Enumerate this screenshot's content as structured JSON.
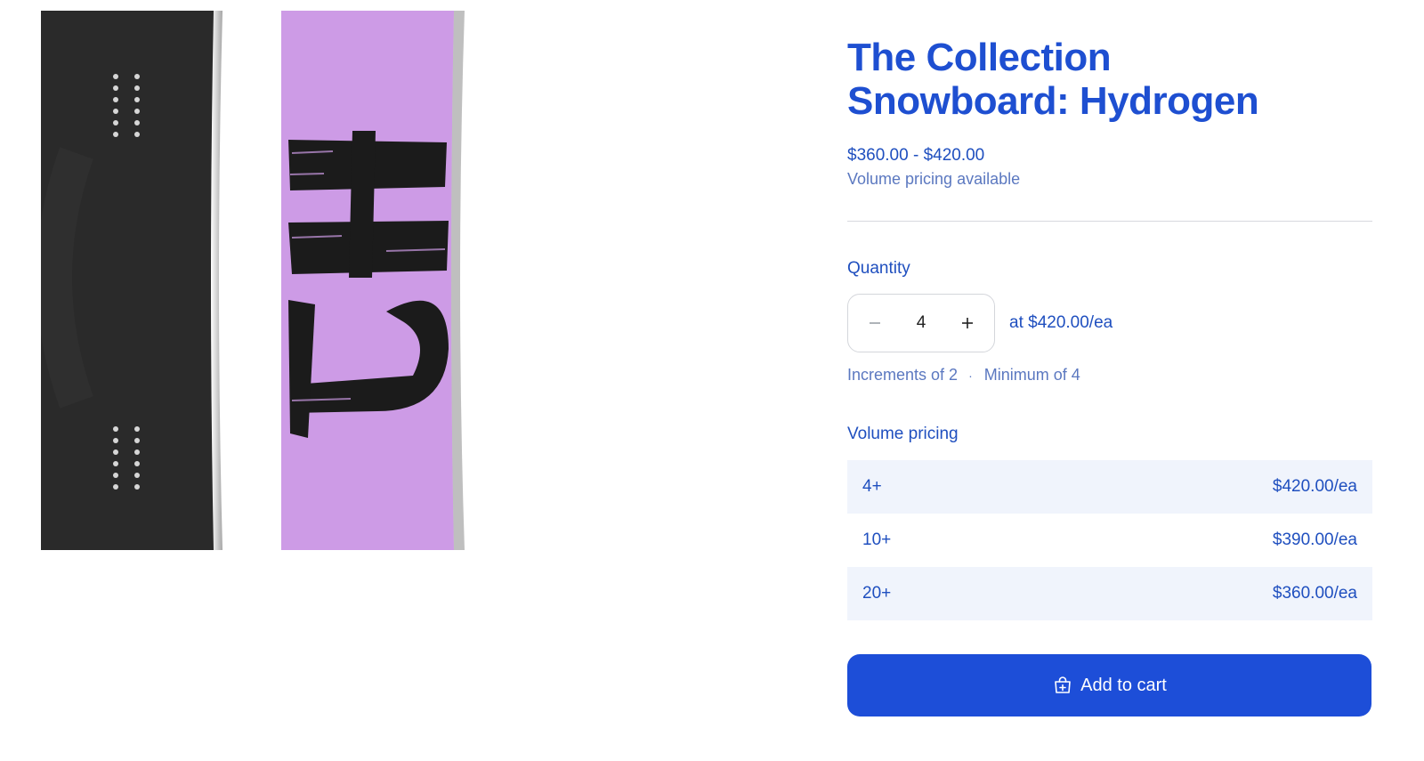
{
  "product": {
    "title_line1": "The Collection",
    "title_line2": "Snowboard: Hydrogen",
    "price_range": "$360.00 - $420.00",
    "volume_note": "Volume pricing available",
    "images": [
      {
        "name": "snowboard-back-image",
        "board_color": "#2b2b2b",
        "insert_color": "#d9d9d9"
      },
      {
        "name": "snowboard-front-image",
        "board_color": "#cd9be6",
        "graphic_color": "#1b1b1b"
      }
    ]
  },
  "quantity": {
    "label": "Quantity",
    "value": "4",
    "decrement_symbol": "−",
    "increment_symbol": "+",
    "unit_price": "at $420.00/ea",
    "increments": "Increments of 2",
    "separator": "·",
    "minimum": "Minimum of 4"
  },
  "volume_pricing": {
    "label": "Volume pricing",
    "tiers": [
      {
        "qty": "4+",
        "price": "$420.00/ea"
      },
      {
        "qty": "10+",
        "price": "$390.00/ea"
      },
      {
        "qty": "20+",
        "price": "$360.00/ea"
      }
    ]
  },
  "cart": {
    "label": "Add to cart",
    "icon": "shopping-bag-plus-icon"
  },
  "colors": {
    "accent": "#1d4ed8",
    "text_primary": "#1f4fbf",
    "text_muted": "#5b78c0",
    "tier_shade": "#f0f4fc"
  }
}
